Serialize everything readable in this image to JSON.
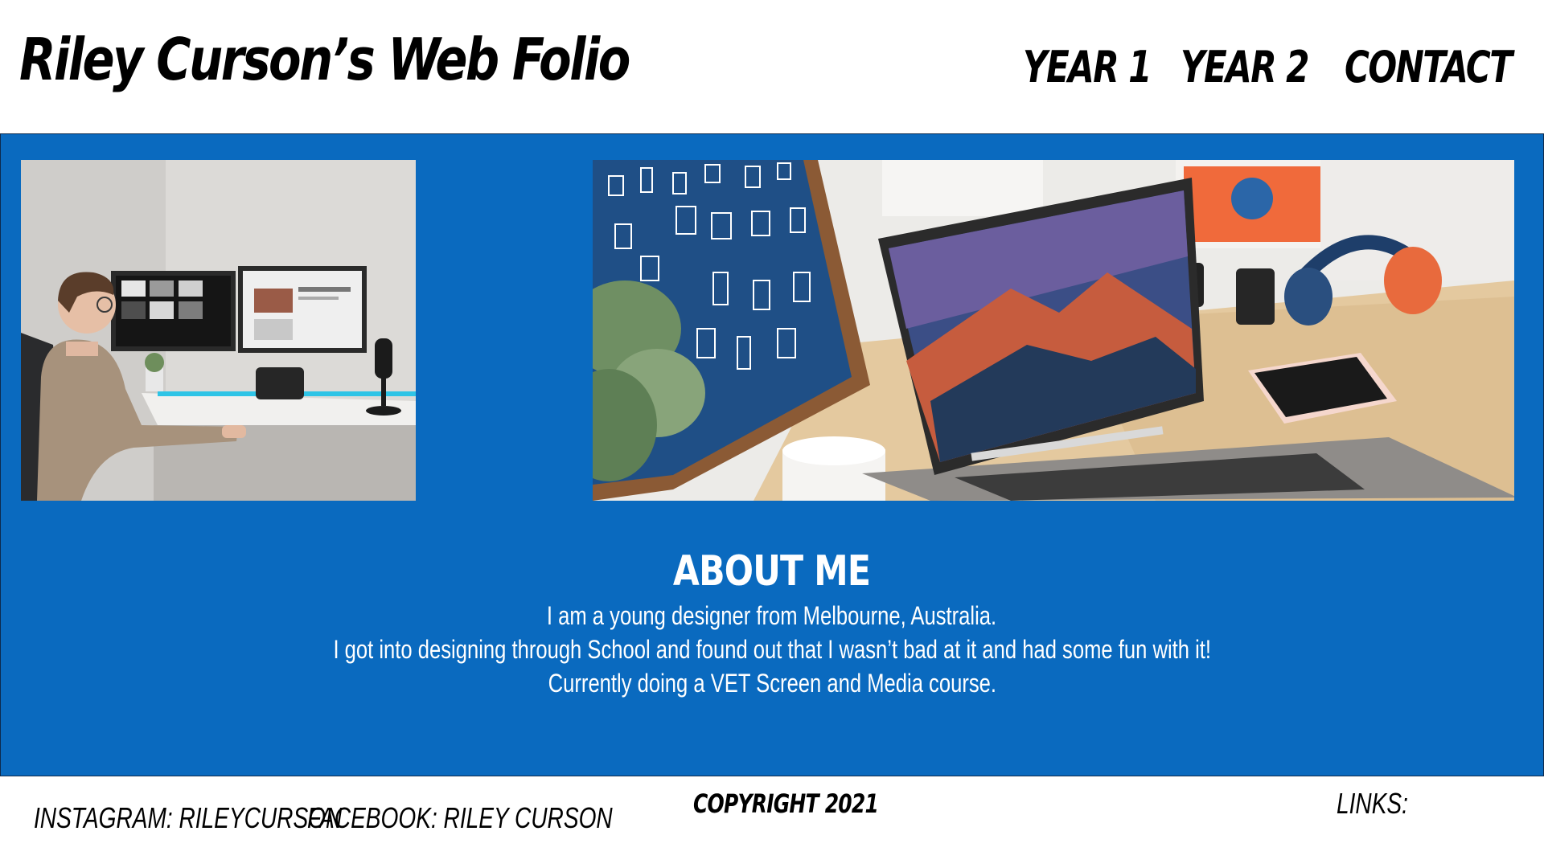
{
  "header": {
    "title": "Riley Curson’s Web Folio",
    "nav": [
      {
        "label": "YEAR 1"
      },
      {
        "label": "YEAR 2"
      },
      {
        "label": "CONTACT"
      }
    ]
  },
  "main": {
    "background_color": "#0a6abf",
    "images": [
      {
        "name": "designer-at-desk-photo"
      },
      {
        "name": "laptop-workspace-photo"
      }
    ],
    "about": {
      "heading": "ABOUT ME",
      "lines": [
        "I am a young designer from Melbourne, Australia.",
        "I got into designing through School and found out that I wasn’t bad at it and had some fun with it!",
        "Currently doing a VET Screen and Media course."
      ]
    }
  },
  "footer": {
    "instagram": "INSTAGRAM: RILEYCURSON",
    "facebook": "FACEBOOK: RILEY CURSON",
    "copyright": "COPYRIGHT 2021",
    "links_label": "LINKS:"
  }
}
